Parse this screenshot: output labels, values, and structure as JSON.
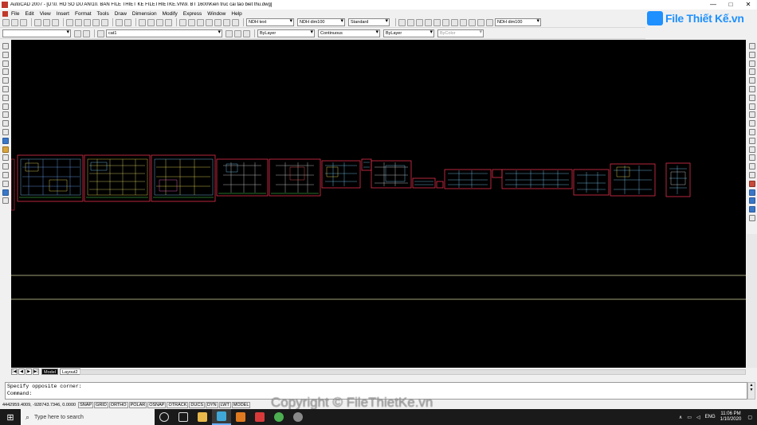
{
  "window": {
    "title": "AutoCAD 2007 - [D:\\0. HO SO DU AN\\10. BAN FILE THIET KE FILETHIETKE.VN\\9. BT 1600\\Kien truc cai tao biet thu.dwg]",
    "minimize": "—",
    "maximize": "□",
    "close": "✕"
  },
  "menu": [
    "File",
    "Edit",
    "View",
    "Insert",
    "Format",
    "Tools",
    "Draw",
    "Dimension",
    "Modify",
    "Express",
    "Window",
    "Help"
  ],
  "logo": {
    "text": "File Thiết Kế.vn",
    "color": "#1e90ff"
  },
  "styles": {
    "text_style": "NDH text",
    "dim_style": "NDH dim100",
    "table_style": "Standard",
    "dim_style_2": "NDH dim100"
  },
  "layers": {
    "workspace": "",
    "current_layer": "cat1"
  },
  "properties": {
    "color": "ByLayer",
    "linetype": "Continuous",
    "lineweight": "ByLayer",
    "plotstyle": "ByColor"
  },
  "tabs": {
    "model": "Model",
    "layout2": "Layout2"
  },
  "command": {
    "history": "Specify opposite corner:",
    "prompt": "Command:"
  },
  "status": {
    "coords": "4442959.4009, -928743.7346, 0.0000",
    "toggles": [
      "SNAP",
      "GRID",
      "ORTHO",
      "POLAR",
      "OSNAP",
      "OTRACK",
      "DUCS",
      "DYN",
      "LWT",
      "MODEL"
    ]
  },
  "watermark": "Copyright © FileThietKe.vn",
  "taskbar": {
    "search_placeholder": "Type here to search",
    "lang": "ENG",
    "time": "11:06 PM",
    "date": "1/10/2020"
  },
  "colors": {
    "canvas": "#000000",
    "accent": "#1e90ff",
    "sheet_border": "#e0304a",
    "guide_line": "#d8d8a0"
  }
}
